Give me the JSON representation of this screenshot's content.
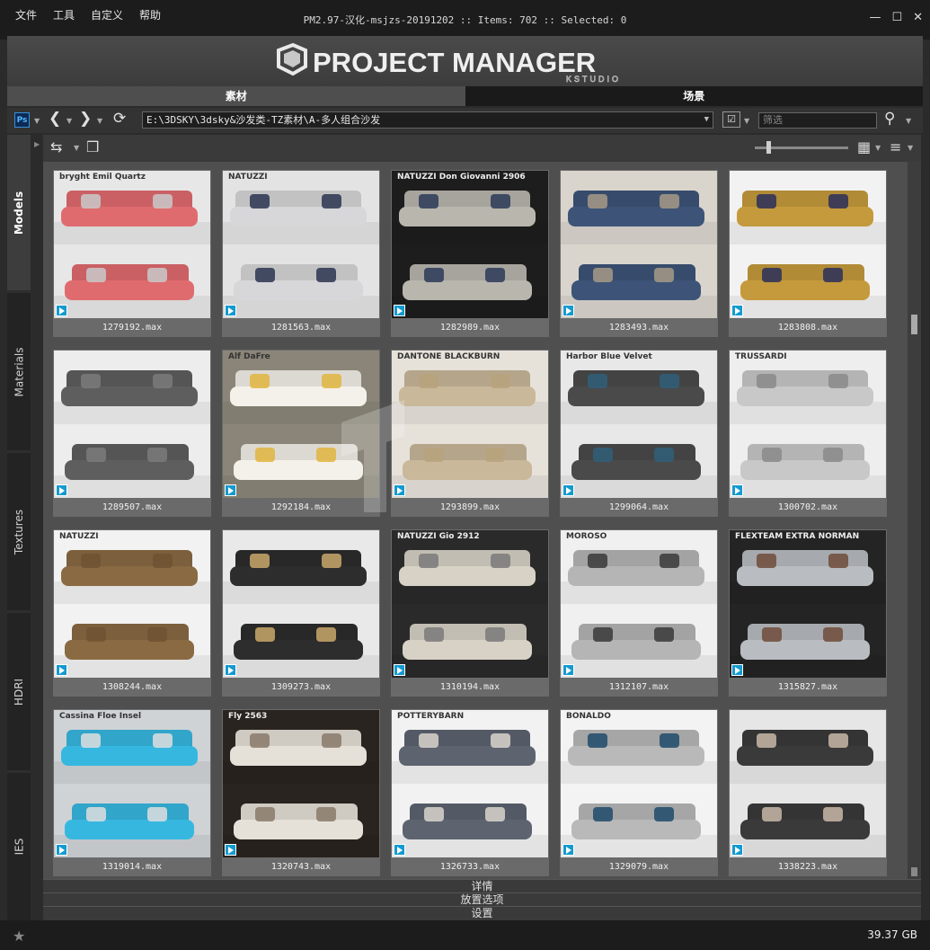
{
  "menu": [
    "文件",
    "工具",
    "自定义",
    "帮助"
  ],
  "window_title": "PM2.97-汉化-msjzs-20191202  :: Items: 702  :: Selected: 0",
  "logo": {
    "main": "PROJECT MANAGER",
    "sub": "KSTUDIO"
  },
  "tabs": [
    {
      "label": "素材",
      "active": true
    },
    {
      "label": "场景",
      "active": false
    }
  ],
  "toolbar": {
    "path": "E:\\3DSKY\\3dsky&沙发类-TZ素材\\A-多人组合沙发",
    "filter_placeholder": "筛选"
  },
  "side_tabs": [
    "Models",
    "Materials",
    "Textures",
    "HDRI",
    "IES"
  ],
  "items": [
    {
      "file": "1279192.max",
      "colors": [
        "#e7e7e7",
        "#e06b6f",
        "#c9c9c9"
      ],
      "brand": "bryght  Emil Quartz"
    },
    {
      "file": "1281563.max",
      "colors": [
        "#e3e3e3",
        "#d7d7d9",
        "#2a3550"
      ],
      "brand": "NATUZZI"
    },
    {
      "file": "1282989.max",
      "colors": [
        "#1d1d1d",
        "#b9b6ae",
        "#2b3a58"
      ],
      "brand": "NATUZZI  Don Giovanni 2906"
    },
    {
      "file": "1283493.max",
      "colors": [
        "#d9d4cc",
        "#3d5478",
        "#a79a86"
      ],
      "brand": ""
    },
    {
      "file": "1283808.max",
      "colors": [
        "#f2f2f2",
        "#c59a3c",
        "#2a2f5a"
      ],
      "brand": ""
    },
    {
      "file": "1289507.max",
      "colors": [
        "#ededed",
        "#5e5e5e",
        "#7b7b7b"
      ],
      "brand": ""
    },
    {
      "file": "1292184.max",
      "colors": [
        "#8a8578",
        "#f4f1ea",
        "#e1b43d"
      ],
      "brand": "Alf DaFre"
    },
    {
      "file": "1293899.max",
      "colors": [
        "#e6e2da",
        "#c9b89a",
        "#b9a27c"
      ],
      "brand": "DANTONE  BLACKBURN"
    },
    {
      "file": "1299064.max",
      "colors": [
        "#e8e8e8",
        "#4a4a4a",
        "#2f5f7a"
      ],
      "brand": "Harbor Blue Velvet"
    },
    {
      "file": "1300702.max",
      "colors": [
        "#eeeeee",
        "#c8c8c8",
        "#8a8a8a"
      ],
      "brand": "TRUSSARDI"
    },
    {
      "file": "1308244.max",
      "colors": [
        "#f2f2f2",
        "#8a6a43",
        "#6f5233"
      ],
      "brand": "NATUZZI"
    },
    {
      "file": "1309273.max",
      "colors": [
        "#e9e9e9",
        "#2d2d2d",
        "#c9a86a"
      ],
      "brand": ""
    },
    {
      "file": "1310194.max",
      "colors": [
        "#2a2a2a",
        "#d8d2c6",
        "#7a7a7a"
      ],
      "brand": "NATUZZI  Gio 2912"
    },
    {
      "file": "1312107.max",
      "colors": [
        "#f0f0f0",
        "#b5b5b5",
        "#3a3a3a"
      ],
      "brand": "MOROSO"
    },
    {
      "file": "1315827.max",
      "colors": [
        "#242424",
        "#b9bcc0",
        "#6f4c3a"
      ],
      "brand": "FLEXTEAM  EXTRA NORMAN"
    },
    {
      "file": "1319014.max",
      "colors": [
        "#cfd3d6",
        "#36b7e0",
        "#dedede"
      ],
      "brand": "Cassina  Floe Insel"
    },
    {
      "file": "1320743.max",
      "colors": [
        "#2a2420",
        "#e6e1d8",
        "#8a7a6a"
      ],
      "brand": "Fly 2563"
    },
    {
      "file": "1326733.max",
      "colors": [
        "#f2f2f2",
        "#5d6470",
        "#d9d5cc"
      ],
      "brand": "POTTERYBARN"
    },
    {
      "file": "1329079.max",
      "colors": [
        "#f3f3f3",
        "#b9b9b9",
        "#1f4a6a"
      ],
      "brand": "BONALDO"
    },
    {
      "file": "1338223.max",
      "colors": [
        "#e6e6e6",
        "#3a3a3a",
        "#c9b8a8"
      ],
      "brand": ""
    }
  ],
  "bottom_panels": [
    "详情",
    "放置选项",
    "设置"
  ],
  "status": {
    "disk_free": "39.37 GB"
  }
}
